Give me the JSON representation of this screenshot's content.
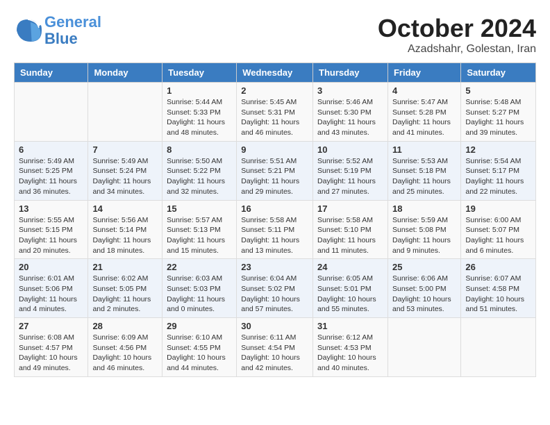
{
  "header": {
    "logo_line1": "General",
    "logo_line2": "Blue",
    "month": "October 2024",
    "location": "Azadshahr, Golestan, Iran"
  },
  "weekdays": [
    "Sunday",
    "Monday",
    "Tuesday",
    "Wednesday",
    "Thursday",
    "Friday",
    "Saturday"
  ],
  "weeks": [
    [
      {
        "day": "",
        "info": ""
      },
      {
        "day": "",
        "info": ""
      },
      {
        "day": "1",
        "info": "Sunrise: 5:44 AM\nSunset: 5:33 PM\nDaylight: 11 hours and 48 minutes."
      },
      {
        "day": "2",
        "info": "Sunrise: 5:45 AM\nSunset: 5:31 PM\nDaylight: 11 hours and 46 minutes."
      },
      {
        "day": "3",
        "info": "Sunrise: 5:46 AM\nSunset: 5:30 PM\nDaylight: 11 hours and 43 minutes."
      },
      {
        "day": "4",
        "info": "Sunrise: 5:47 AM\nSunset: 5:28 PM\nDaylight: 11 hours and 41 minutes."
      },
      {
        "day": "5",
        "info": "Sunrise: 5:48 AM\nSunset: 5:27 PM\nDaylight: 11 hours and 39 minutes."
      }
    ],
    [
      {
        "day": "6",
        "info": "Sunrise: 5:49 AM\nSunset: 5:25 PM\nDaylight: 11 hours and 36 minutes."
      },
      {
        "day": "7",
        "info": "Sunrise: 5:49 AM\nSunset: 5:24 PM\nDaylight: 11 hours and 34 minutes."
      },
      {
        "day": "8",
        "info": "Sunrise: 5:50 AM\nSunset: 5:22 PM\nDaylight: 11 hours and 32 minutes."
      },
      {
        "day": "9",
        "info": "Sunrise: 5:51 AM\nSunset: 5:21 PM\nDaylight: 11 hours and 29 minutes."
      },
      {
        "day": "10",
        "info": "Sunrise: 5:52 AM\nSunset: 5:19 PM\nDaylight: 11 hours and 27 minutes."
      },
      {
        "day": "11",
        "info": "Sunrise: 5:53 AM\nSunset: 5:18 PM\nDaylight: 11 hours and 25 minutes."
      },
      {
        "day": "12",
        "info": "Sunrise: 5:54 AM\nSunset: 5:17 PM\nDaylight: 11 hours and 22 minutes."
      }
    ],
    [
      {
        "day": "13",
        "info": "Sunrise: 5:55 AM\nSunset: 5:15 PM\nDaylight: 11 hours and 20 minutes."
      },
      {
        "day": "14",
        "info": "Sunrise: 5:56 AM\nSunset: 5:14 PM\nDaylight: 11 hours and 18 minutes."
      },
      {
        "day": "15",
        "info": "Sunrise: 5:57 AM\nSunset: 5:13 PM\nDaylight: 11 hours and 15 minutes."
      },
      {
        "day": "16",
        "info": "Sunrise: 5:58 AM\nSunset: 5:11 PM\nDaylight: 11 hours and 13 minutes."
      },
      {
        "day": "17",
        "info": "Sunrise: 5:58 AM\nSunset: 5:10 PM\nDaylight: 11 hours and 11 minutes."
      },
      {
        "day": "18",
        "info": "Sunrise: 5:59 AM\nSunset: 5:08 PM\nDaylight: 11 hours and 9 minutes."
      },
      {
        "day": "19",
        "info": "Sunrise: 6:00 AM\nSunset: 5:07 PM\nDaylight: 11 hours and 6 minutes."
      }
    ],
    [
      {
        "day": "20",
        "info": "Sunrise: 6:01 AM\nSunset: 5:06 PM\nDaylight: 11 hours and 4 minutes."
      },
      {
        "day": "21",
        "info": "Sunrise: 6:02 AM\nSunset: 5:05 PM\nDaylight: 11 hours and 2 minutes."
      },
      {
        "day": "22",
        "info": "Sunrise: 6:03 AM\nSunset: 5:03 PM\nDaylight: 11 hours and 0 minutes."
      },
      {
        "day": "23",
        "info": "Sunrise: 6:04 AM\nSunset: 5:02 PM\nDaylight: 10 hours and 57 minutes."
      },
      {
        "day": "24",
        "info": "Sunrise: 6:05 AM\nSunset: 5:01 PM\nDaylight: 10 hours and 55 minutes."
      },
      {
        "day": "25",
        "info": "Sunrise: 6:06 AM\nSunset: 5:00 PM\nDaylight: 10 hours and 53 minutes."
      },
      {
        "day": "26",
        "info": "Sunrise: 6:07 AM\nSunset: 4:58 PM\nDaylight: 10 hours and 51 minutes."
      }
    ],
    [
      {
        "day": "27",
        "info": "Sunrise: 6:08 AM\nSunset: 4:57 PM\nDaylight: 10 hours and 49 minutes."
      },
      {
        "day": "28",
        "info": "Sunrise: 6:09 AM\nSunset: 4:56 PM\nDaylight: 10 hours and 46 minutes."
      },
      {
        "day": "29",
        "info": "Sunrise: 6:10 AM\nSunset: 4:55 PM\nDaylight: 10 hours and 44 minutes."
      },
      {
        "day": "30",
        "info": "Sunrise: 6:11 AM\nSunset: 4:54 PM\nDaylight: 10 hours and 42 minutes."
      },
      {
        "day": "31",
        "info": "Sunrise: 6:12 AM\nSunset: 4:53 PM\nDaylight: 10 hours and 40 minutes."
      },
      {
        "day": "",
        "info": ""
      },
      {
        "day": "",
        "info": ""
      }
    ]
  ]
}
